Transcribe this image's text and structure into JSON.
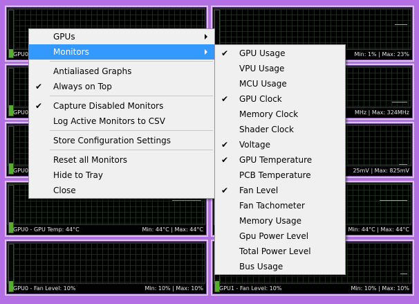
{
  "graphs": [
    {
      "label": "GPU0",
      "minmax": ""
    },
    {
      "label": "",
      "minmax": "Min: 1% | Max: 23%"
    },
    {
      "label": "GPU0",
      "minmax": ""
    },
    {
      "label": "",
      "minmax": "MHz | Max: 324MHz"
    },
    {
      "label": "GPU0",
      "minmax": ""
    },
    {
      "label": "",
      "minmax": "25mV | Max: 825mV"
    },
    {
      "label": "GPU0 - GPU Temp: 44°C",
      "minmax": "Min: 44°C | Max: 44°C"
    },
    {
      "label": "",
      "minmax": "Min: 44°C | Max: 44°C"
    },
    {
      "label": "GPU0 - Fan Level: 10%",
      "minmax": "Min: 10% | Max: 10%"
    },
    {
      "label": "GPU1 - Fan Level: 10%",
      "minmax": "Min: 10% | Max: 10%"
    }
  ],
  "context_menu": [
    {
      "label": "GPUs",
      "submenu": true
    },
    {
      "label": "Monitors",
      "submenu": true,
      "selected": true
    },
    {
      "separator": true
    },
    {
      "label": "Antialiased Graphs"
    },
    {
      "label": "Always on Top",
      "checked": true
    },
    {
      "separator": true
    },
    {
      "label": "Capture Disabled Monitors",
      "checked": true
    },
    {
      "label": "Log Active Monitors to CSV"
    },
    {
      "separator": true
    },
    {
      "label": "Store Configuration Settings"
    },
    {
      "separator": true
    },
    {
      "label": "Reset all Monitors"
    },
    {
      "label": "Hide to Tray"
    },
    {
      "label": "Close"
    }
  ],
  "monitors_submenu": [
    {
      "label": "GPU Usage",
      "checked": true
    },
    {
      "label": "VPU Usage"
    },
    {
      "label": "MCU Usage"
    },
    {
      "label": "GPU Clock",
      "checked": true
    },
    {
      "label": "Memory Clock"
    },
    {
      "label": "Shader Clock"
    },
    {
      "label": "Voltage",
      "checked": true
    },
    {
      "label": "GPU Temperature",
      "checked": true
    },
    {
      "label": "PCB Temperature"
    },
    {
      "label": "Fan Level",
      "checked": true
    },
    {
      "label": "Fan Tachometer"
    },
    {
      "label": "Memory Usage"
    },
    {
      "label": "Gpu Power Level"
    },
    {
      "label": "Total Power Level"
    },
    {
      "label": "Bus Usage"
    }
  ],
  "symbols": {
    "check": "✔"
  },
  "colors": {
    "background": "#b46fe4",
    "graph_bg": "#000000",
    "grid": "#172b17",
    "trace": "#6ad43a",
    "menu_bg": "#f0f0f0",
    "highlight": "#3399ff"
  }
}
